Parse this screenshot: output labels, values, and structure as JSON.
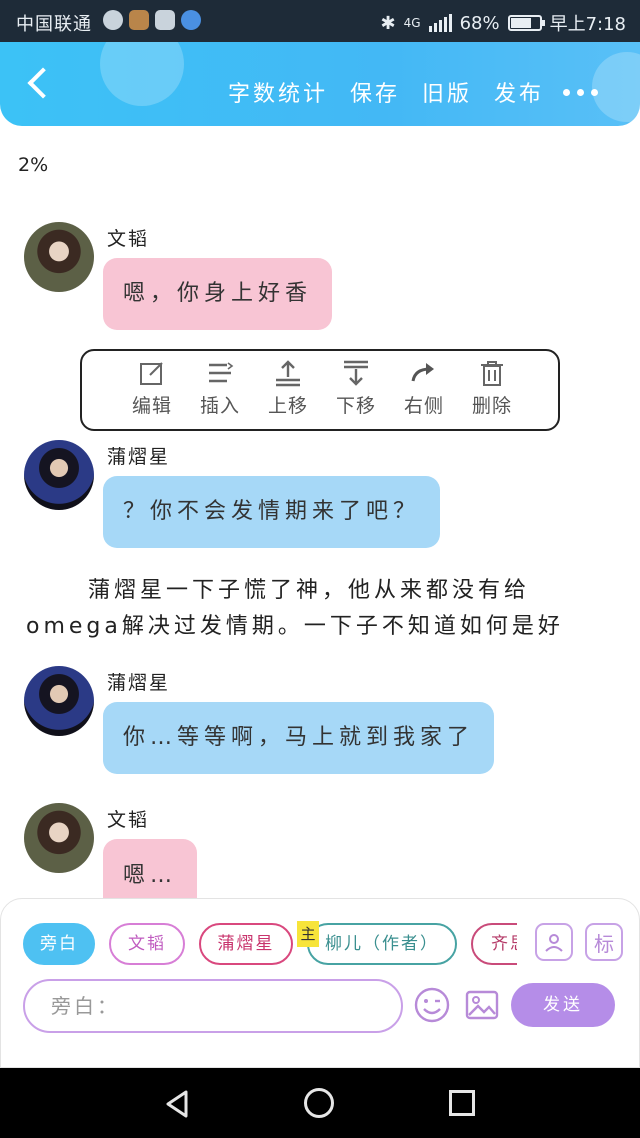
{
  "status_bar": {
    "carrier": "中国联通",
    "network": "4G",
    "battery": "68%",
    "time": "早上7:18",
    "bluetooth_icon": "bluetooth-icon"
  },
  "toolbar": {
    "back_icon": "chevron-left-icon",
    "word_count": "字数统计",
    "save": "保存",
    "old_version": "旧版",
    "publish": "发布",
    "more_icon": "more-dots-icon"
  },
  "progress": "2%",
  "messages": [
    {
      "sender": "文韬",
      "text": "嗯，你身上好香",
      "color": "#f8c5d4"
    },
    {
      "sender": "蒲熠星",
      "text": "？你不会发情期来了吧？",
      "color": "#a6d8f7"
    },
    {
      "sender": "蒲熠星",
      "text": "你…等等啊，马上就到我家了",
      "color": "#a6d8f7"
    },
    {
      "sender": "文韬",
      "text": "嗯…",
      "color": "#f8c5d4"
    }
  ],
  "edit_menu": {
    "items": [
      {
        "label": "编辑",
        "icon": "edit-icon"
      },
      {
        "label": "插入",
        "icon": "insert-icon"
      },
      {
        "label": "上移",
        "icon": "move-up-icon"
      },
      {
        "label": "下移",
        "icon": "move-down-icon"
      },
      {
        "label": "右侧",
        "icon": "redo-arrow-icon"
      },
      {
        "label": "删除",
        "icon": "trash-icon"
      }
    ]
  },
  "narration": {
    "line1": "蒲熠星一下子慌了神，他从来都没有给",
    "line2": "omega解决过发情期。一下子不知道如何是好"
  },
  "composer": {
    "roles": [
      "旁白",
      "文韬",
      "蒲熠星",
      "柳儿（作者）",
      "齐思钧"
    ],
    "main_badge": "主",
    "input_placeholder": "旁白：",
    "send_label": "发送",
    "side_button_1": "person-card-icon",
    "side_button_2": "标",
    "emoji_icon": "emoji-icon",
    "image_icon": "image-icon"
  },
  "nav_bar": {
    "back": "back-triangle-icon",
    "home": "home-circle-icon",
    "recents": "recents-square-icon"
  }
}
